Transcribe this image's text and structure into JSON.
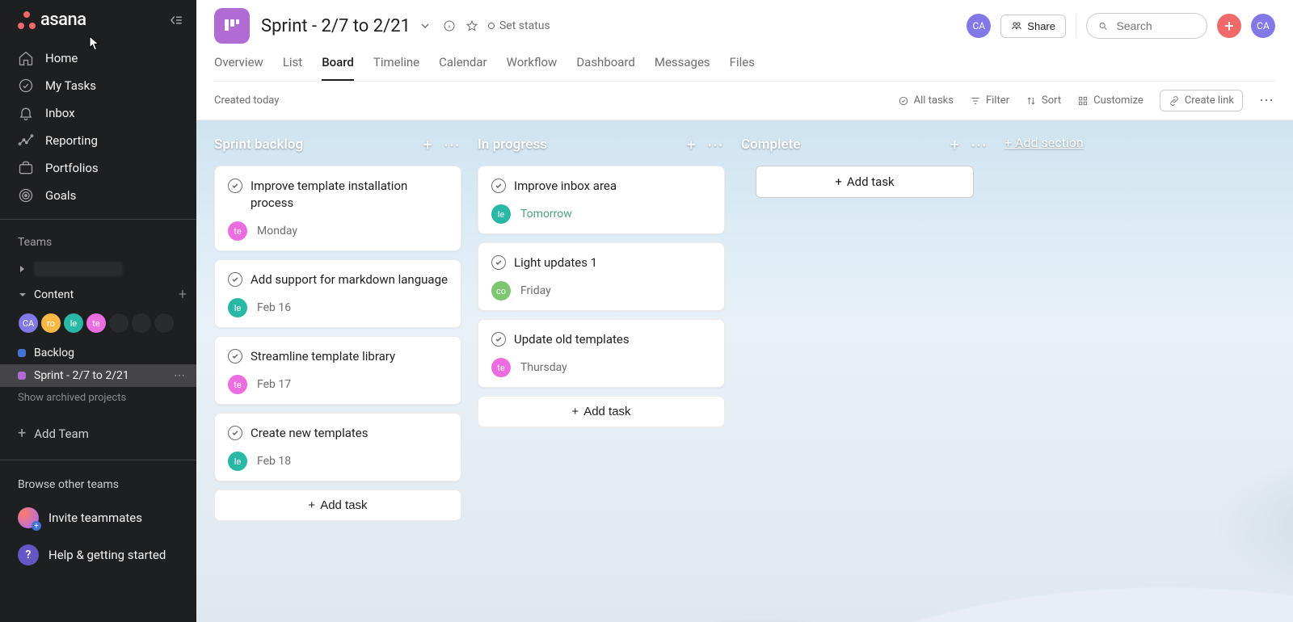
{
  "app": {
    "name": "asana"
  },
  "sidebar": {
    "primary": [
      {
        "label": "Home"
      },
      {
        "label": "My Tasks"
      },
      {
        "label": "Inbox"
      },
      {
        "label": "Reporting"
      },
      {
        "label": "Portfolios"
      },
      {
        "label": "Goals"
      }
    ],
    "teams_label": "Teams",
    "team_content_label": "Content",
    "avatars": [
      {
        "initials": "CA",
        "color": "#8378e8"
      },
      {
        "initials": "ro",
        "color": "#f7b844"
      },
      {
        "initials": "le",
        "color": "#2ab8a6"
      },
      {
        "initials": "te",
        "color": "#ec6ddf"
      }
    ],
    "projects": [
      {
        "label": "Backlog",
        "dot": "#4573d2",
        "active": false
      },
      {
        "label": "Sprint - 2/7 to 2/21",
        "dot": "#b36bd4",
        "active": true
      }
    ],
    "show_archived": "Show archived projects",
    "add_team": "Add Team",
    "browse_label": "Browse other teams",
    "invite_label": "Invite teammates",
    "help_label": "Help & getting started"
  },
  "header": {
    "title": "Sprint - 2/7 to 2/21",
    "set_status": "Set status",
    "share": "Share",
    "search_placeholder": "Search",
    "user_initials": "CA",
    "left_avatar_initials": "CA",
    "tabs": [
      "Overview",
      "List",
      "Board",
      "Timeline",
      "Calendar",
      "Workflow",
      "Dashboard",
      "Messages",
      "Files"
    ],
    "active_tab": "Board"
  },
  "toolbar": {
    "created": "Created today",
    "all_tasks": "All tasks",
    "filter": "Filter",
    "sort": "Sort",
    "customize": "Customize",
    "create_link": "Create link"
  },
  "board": {
    "add_task": "Add task",
    "add_section": "+ Add section",
    "columns": [
      {
        "title": "Sprint backlog",
        "cards": [
          {
            "title": "Improve template installation process",
            "assignee": {
              "initials": "te",
              "color": "#ec6ddf"
            },
            "due": "Monday",
            "soon": false
          },
          {
            "title": "Add support for markdown language",
            "assignee": {
              "initials": "le",
              "color": "#2ab8a6"
            },
            "due": "Feb 16",
            "soon": false
          },
          {
            "title": "Streamline template library",
            "assignee": {
              "initials": "te",
              "color": "#ec6ddf"
            },
            "due": "Feb 17",
            "soon": false
          },
          {
            "title": "Create new templates",
            "assignee": {
              "initials": "le",
              "color": "#2ab8a6"
            },
            "due": "Feb 18",
            "soon": false
          }
        ]
      },
      {
        "title": "In progress",
        "cards": [
          {
            "title": "Improve inbox area",
            "assignee": {
              "initials": "le",
              "color": "#2ab8a6"
            },
            "due": "Tomorrow",
            "soon": true
          },
          {
            "title": "Light updates 1",
            "assignee": {
              "initials": "co",
              "color": "#7bc66f"
            },
            "due": "Friday",
            "soon": false
          },
          {
            "title": "Update old templates",
            "assignee": {
              "initials": "te",
              "color": "#ec6ddf"
            },
            "due": "Thursday",
            "soon": false
          }
        ]
      },
      {
        "title": "Complete",
        "cards": []
      }
    ]
  }
}
